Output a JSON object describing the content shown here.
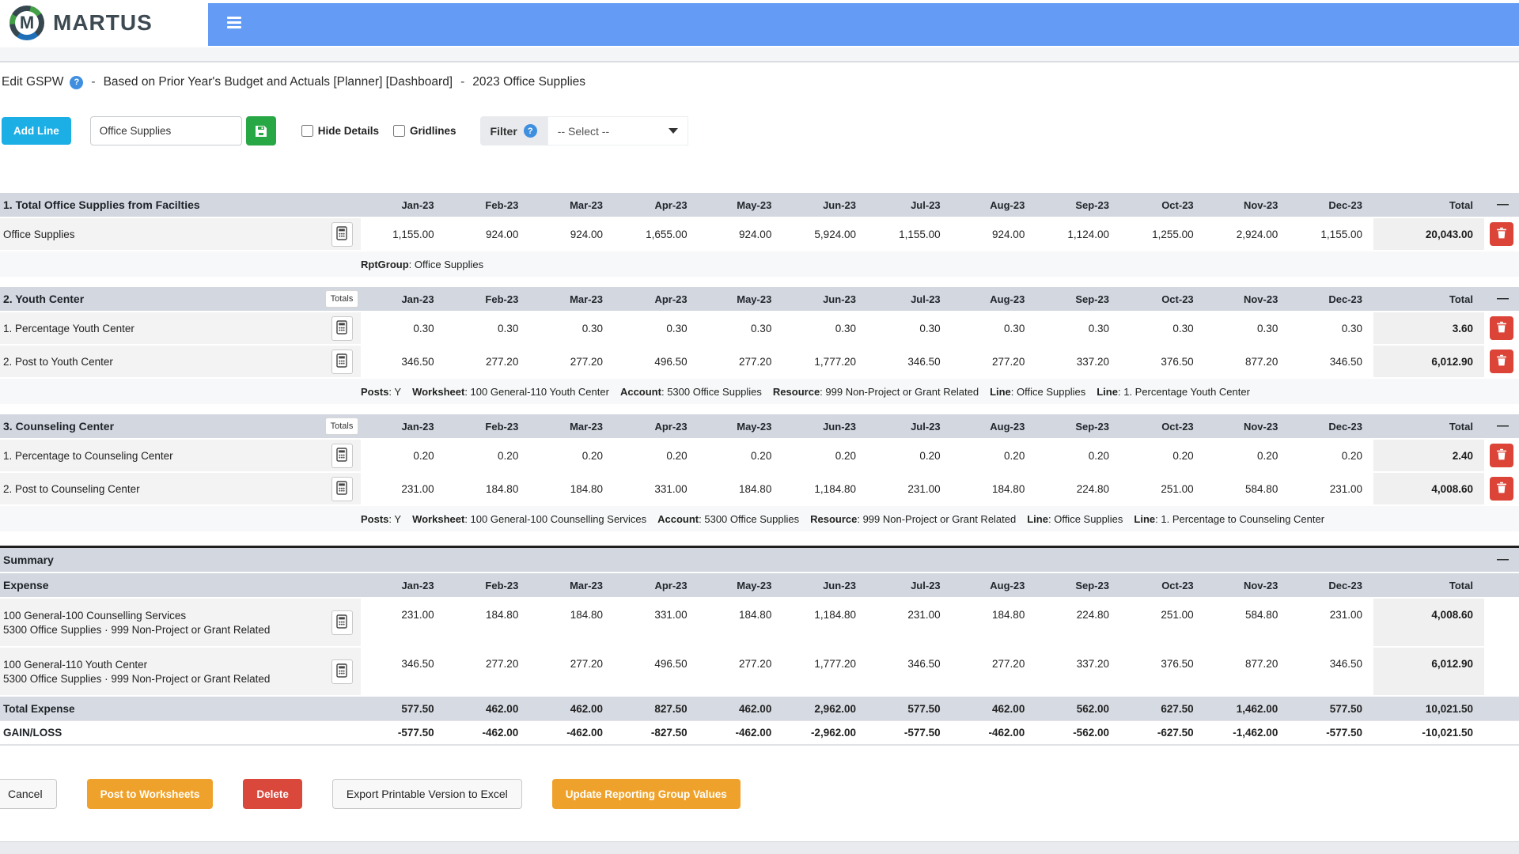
{
  "brand": {
    "name": "MARTUS",
    "logo_letter": "M"
  },
  "title_bar": {
    "title": "Edit GSPW",
    "separator": "-",
    "description": "Based on Prior Year's Budget and Actuals [Planner] [Dashboard]",
    "context": "2023 Office Supplies",
    "help_glyph": "?"
  },
  "toolbar": {
    "add_line_label": "Add Line",
    "line_name_value": "Office Supplies",
    "hide_details_label": "Hide Details",
    "gridlines_label": "Gridlines",
    "filter_label": "Filter",
    "filter_help_glyph": "?",
    "filter_select_value": "-- Select --"
  },
  "table": {
    "months": [
      "Jan-23",
      "Feb-23",
      "Mar-23",
      "Apr-23",
      "May-23",
      "Jun-23",
      "Jul-23",
      "Aug-23",
      "Sep-23",
      "Oct-23",
      "Nov-23",
      "Dec-23"
    ],
    "total_label": "Total",
    "totals_button_label": "Totals",
    "collapse_glyph": "—",
    "sections": [
      {
        "title": "1. Total Office Supplies from Facilties",
        "totals_button": false,
        "rows": [
          {
            "label": "Office Supplies",
            "values": [
              "1,155.00",
              "924.00",
              "924.00",
              "1,655.00",
              "924.00",
              "5,924.00",
              "1,155.00",
              "924.00",
              "1,124.00",
              "1,255.00",
              "2,924.00",
              "1,155.00"
            ],
            "total": "20,043.00",
            "detail": [
              {
                "label": "RptGroup",
                "value": "Office Supplies"
              }
            ]
          }
        ]
      },
      {
        "title": "2. Youth Center",
        "totals_button": true,
        "rows": [
          {
            "label": "1. Percentage Youth Center",
            "values": [
              "0.30",
              "0.30",
              "0.30",
              "0.30",
              "0.30",
              "0.30",
              "0.30",
              "0.30",
              "0.30",
              "0.30",
              "0.30",
              "0.30"
            ],
            "total": "3.60"
          },
          {
            "label": "2. Post to Youth Center",
            "values": [
              "346.50",
              "277.20",
              "277.20",
              "496.50",
              "277.20",
              "1,777.20",
              "346.50",
              "277.20",
              "337.20",
              "376.50",
              "877.20",
              "346.50"
            ],
            "total": "6,012.90",
            "detail": [
              {
                "label": "Posts",
                "value": "Y"
              },
              {
                "label": "Worksheet",
                "value": "100 General-110 Youth Center"
              },
              {
                "label": "Account",
                "value": "5300 Office Supplies"
              },
              {
                "label": "Resource",
                "value": "999 Non-Project or Grant Related"
              },
              {
                "label": "Line",
                "value": "Office Supplies"
              },
              {
                "label": "Line",
                "value": "1. Percentage Youth Center"
              }
            ]
          }
        ]
      },
      {
        "title": "3. Counseling Center",
        "totals_button": true,
        "rows": [
          {
            "label": "1. Percentage to Counseling Center",
            "values": [
              "0.20",
              "0.20",
              "0.20",
              "0.20",
              "0.20",
              "0.20",
              "0.20",
              "0.20",
              "0.20",
              "0.20",
              "0.20",
              "0.20"
            ],
            "total": "2.40"
          },
          {
            "label": "2. Post to Counseling Center",
            "values": [
              "231.00",
              "184.80",
              "184.80",
              "331.00",
              "184.80",
              "1,184.80",
              "231.00",
              "184.80",
              "224.80",
              "251.00",
              "584.80",
              "231.00"
            ],
            "total": "4,008.60",
            "detail": [
              {
                "label": "Posts",
                "value": "Y"
              },
              {
                "label": "Worksheet",
                "value": "100 General-100 Counselling Services"
              },
              {
                "label": "Account",
                "value": "5300 Office Supplies"
              },
              {
                "label": "Resource",
                "value": "999 Non-Project or Grant Related"
              },
              {
                "label": "Line",
                "value": "Office Supplies"
              },
              {
                "label": "Line",
                "value": "1. Percentage to Counseling Center"
              }
            ]
          }
        ]
      }
    ],
    "summary": {
      "title": "Summary",
      "group_label": "Expense",
      "rows": [
        {
          "label": "100 General-100 Counselling Services",
          "sublabel": "5300 Office Supplies · 999 Non-Project or Grant Related",
          "values": [
            "231.00",
            "184.80",
            "184.80",
            "331.00",
            "184.80",
            "1,184.80",
            "231.00",
            "184.80",
            "224.80",
            "251.00",
            "584.80",
            "231.00"
          ],
          "total": "4,008.60"
        },
        {
          "label": "100 General-110 Youth Center",
          "sublabel": "5300 Office Supplies · 999 Non-Project or Grant Related",
          "values": [
            "346.50",
            "277.20",
            "277.20",
            "496.50",
            "277.20",
            "1,777.20",
            "346.50",
            "277.20",
            "337.20",
            "376.50",
            "877.20",
            "346.50"
          ],
          "total": "6,012.90"
        }
      ],
      "total_expense": {
        "label": "Total Expense",
        "values": [
          "577.50",
          "462.00",
          "462.00",
          "827.50",
          "462.00",
          "2,962.00",
          "577.50",
          "462.00",
          "562.00",
          "627.50",
          "1,462.00",
          "577.50"
        ],
        "total": "10,021.50"
      },
      "gain_loss": {
        "label": "GAIN/LOSS",
        "values": [
          "-577.50",
          "-462.00",
          "-462.00",
          "-827.50",
          "-462.00",
          "-2,962.00",
          "-577.50",
          "-462.00",
          "-562.00",
          "-627.50",
          "-1,462.00",
          "-577.50"
        ],
        "total": "-10,021.50"
      }
    }
  },
  "footer": {
    "buttons": [
      {
        "label": "Cancel",
        "style": "light cancel"
      },
      {
        "label": "Post to Worksheets",
        "style": "orange"
      },
      {
        "label": "Delete",
        "style": "red"
      },
      {
        "label": "Export Printable Version to Excel",
        "style": "light"
      },
      {
        "label": "Update Reporting Group Values",
        "style": "orange"
      }
    ]
  },
  "colors": {
    "nav_blue": "#649cf5",
    "add_line_cyan": "#1cafe6",
    "save_green": "#28a745",
    "header_gray": "#d2d7e0",
    "trash_red": "#db4437",
    "button_orange": "#efa22b",
    "button_red": "#d9483b"
  }
}
